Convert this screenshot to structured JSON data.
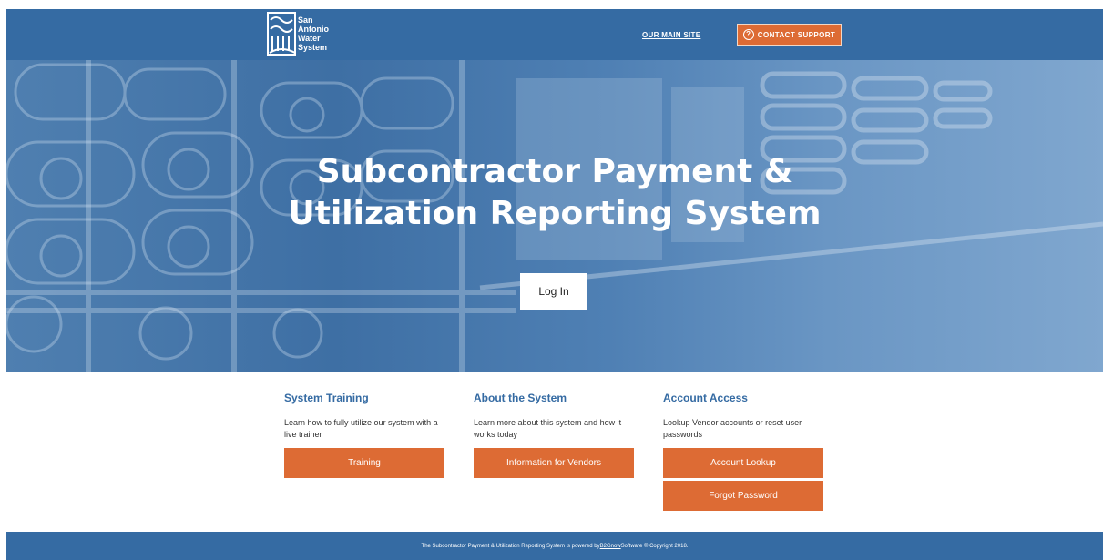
{
  "header": {
    "logo_lines": [
      "San",
      "Antonio",
      "Water",
      "System"
    ],
    "main_site_link": "OUR MAIN SITE",
    "contact_support": "CONTACT SUPPORT",
    "contact_icon_glyph": "?"
  },
  "hero": {
    "title_line1": "Subcontractor Payment &",
    "title_line2": "Utilization Reporting System",
    "login_button": "Log In"
  },
  "sections": [
    {
      "heading": "System Training",
      "text": "Learn how to fully utilize our system with a live trainer",
      "buttons": [
        "Training"
      ]
    },
    {
      "heading": "About the System",
      "text": "Learn more about this system and how it works today",
      "buttons": [
        "Information for Vendors"
      ]
    },
    {
      "heading": "Account Access",
      "text": "Lookup Vendor accounts or reset user passwords",
      "buttons": [
        "Account Lookup",
        "Forgot Password"
      ]
    }
  ],
  "footer": {
    "text_before": "The Subcontractor Payment & Utilization Reporting System is powered by ",
    "link": "B2Gnow",
    "text_after": " Software © Copyright 2018."
  },
  "colors": {
    "brand_blue": "#356ba3",
    "accent_orange": "#dd6b34"
  }
}
